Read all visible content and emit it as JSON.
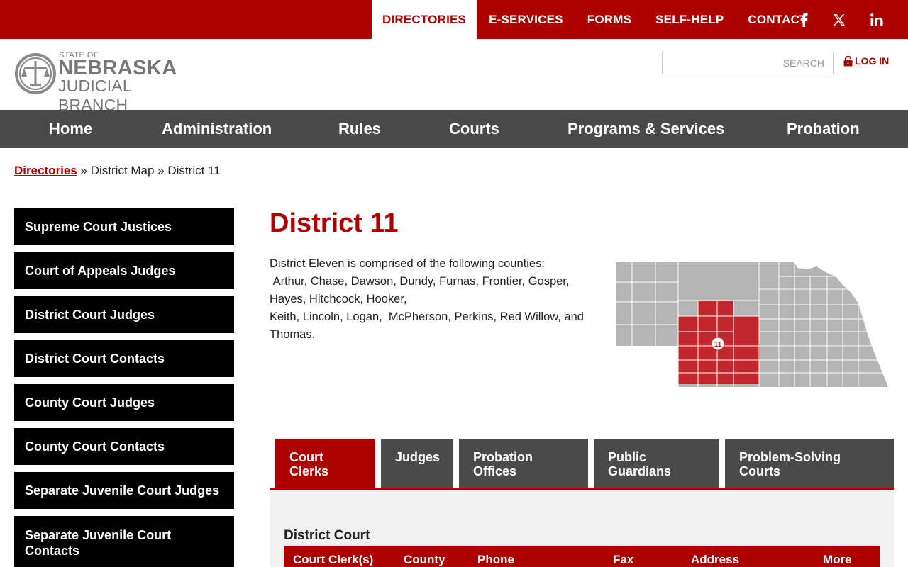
{
  "topbar": {
    "links": [
      {
        "label": "DIRECTORIES",
        "active": true
      },
      {
        "label": "E-SERVICES"
      },
      {
        "label": "FORMS"
      },
      {
        "label": "SELF-HELP"
      },
      {
        "label": "CONTACT"
      }
    ],
    "social_icons": [
      "facebook-icon",
      "x-twitter-icon",
      "linkedin-icon"
    ]
  },
  "logo": {
    "line1": "STATE OF",
    "line2": "NEBRASKA",
    "line3": "JUDICIAL BRANCH"
  },
  "search": {
    "placeholder": "SEARCH"
  },
  "login": {
    "label": "LOG IN"
  },
  "nav": [
    "Home",
    "Administration",
    "Rules",
    "Courts",
    "Programs & Services",
    "Probation"
  ],
  "breadcrumb": {
    "link": "Directories",
    "sep": " » ",
    "item2": "District Map",
    "item3": "District 11"
  },
  "sidebar": [
    "Supreme Court Justices",
    "Court of Appeals Judges",
    "District Court Judges",
    "District Court Contacts",
    "County Court Judges",
    "County Court Contacts",
    "Separate Juvenile Court Judges",
    "Separate Juvenile Court Contacts"
  ],
  "page": {
    "title": "District 11",
    "desc_line1": "District Eleven is comprised of the following counties:",
    "desc_line2": " Arthur, Chase, Dawson, Dundy, Furnas, Frontier, Gosper, Hayes, Hitchcock, Hooker,",
    "desc_line3": "Keith, Lincoln, Logan,  McPherson, Perkins, Red Willow, and Thomas."
  },
  "map": {
    "district_label": "11",
    "highlight_color": "#c1272d",
    "base_color": "#b5b5b5"
  },
  "tabs": [
    "Court Clerks",
    "Judges",
    "Probation Offices",
    "Public Guardians",
    "Problem-Solving Courts"
  ],
  "panel": {
    "heading": "District Court",
    "columns": [
      "Court Clerk(s)",
      "County",
      "Phone",
      "Fax",
      "Address",
      "More"
    ]
  },
  "colors": {
    "brand_red": "#ad0000",
    "nav_gray": "#4a4a4a"
  }
}
